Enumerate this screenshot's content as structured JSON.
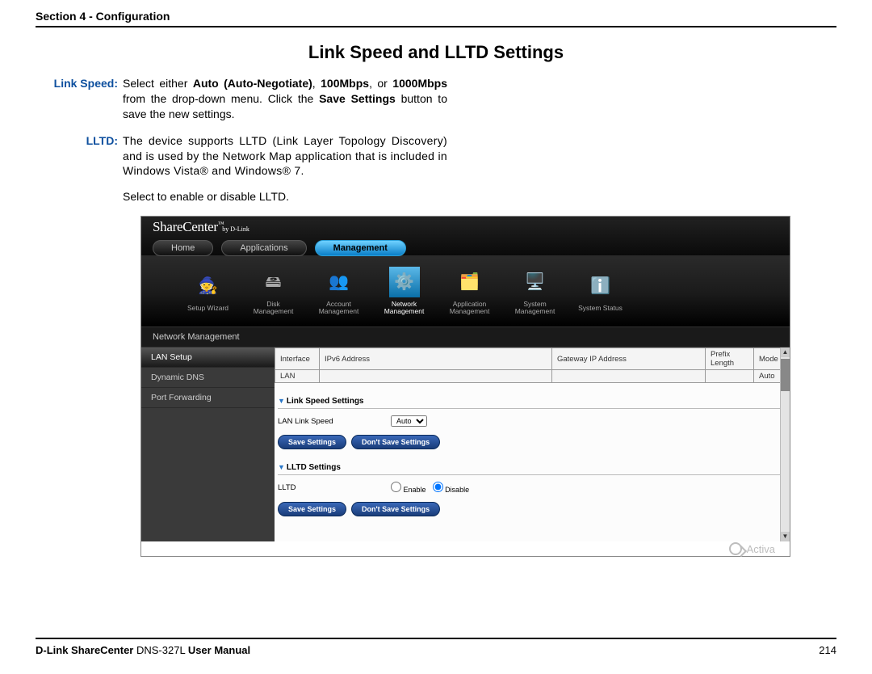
{
  "header": {
    "section": "Section 4 - Configuration"
  },
  "title": "Link Speed and LLTD Settings",
  "definitions": {
    "linkspeed": {
      "label": "Link Speed:",
      "text_parts": {
        "a": "Select either ",
        "b": "Auto (Auto-Negotiate)",
        "c": ", ",
        "d": "100Mbps",
        "e": ", or ",
        "f": "1000Mbps",
        "g": " from the drop-down menu. Click the ",
        "h": "Save Settings",
        "i": " button to save the new settings."
      }
    },
    "lltd": {
      "label": "LLTD:",
      "text": "The device supports LLTD (Link Layer Topology Discovery) and is used by the Network Map application that is included in Windows Vista® and Windows® 7."
    },
    "extra": "Select to enable or disable LLTD."
  },
  "screenshot": {
    "logo": "ShareCenter",
    "logo_tm": "™",
    "logo_sub": "by D-Link",
    "tabs": {
      "home": "Home",
      "apps": "Applications",
      "mgmt": "Management"
    },
    "toolbar": {
      "wizard": "Setup Wizard",
      "disk": "Disk\nManagement",
      "account": "Account\nManagement",
      "network": "Network\nManagement",
      "appmgmt": "Application\nManagement",
      "system": "System\nManagement",
      "status": "System Status"
    },
    "icons": {
      "wizard": "🧙",
      "disk": "🖴",
      "account": "👥",
      "network": "⚙️",
      "appmgmt": "🗂️",
      "system": "🖥️",
      "status": "ℹ️"
    },
    "subbar": "Network Management",
    "sidebar": {
      "lan": "LAN Setup",
      "ddns": "Dynamic DNS",
      "port": "Port Forwarding"
    },
    "table": {
      "headers": {
        "iface": "Interface",
        "ipv6": "IPv6 Address",
        "gw": "Gateway IP Address",
        "pfx": "Prefix Length",
        "mode": "Mode"
      },
      "row": {
        "iface": "LAN",
        "ipv6": "",
        "gw": "",
        "pfx": "",
        "mode": "Auto"
      }
    },
    "sections": {
      "linkspeed": {
        "title": "Link Speed Settings",
        "label": "LAN  Link Speed",
        "select_value": "Auto",
        "save": "Save Settings",
        "dont": "Don't Save Settings"
      },
      "lltd": {
        "title": "LLTD Settings",
        "label": "LLTD",
        "enable": "Enable",
        "disable": "Disable",
        "save": "Save Settings",
        "dont": "Don't Save Settings"
      }
    },
    "watermark": "Activa"
  },
  "footer": {
    "brand": "D-Link ShareCenter",
    "model": " DNS-327L ",
    "suffix": "User Manual",
    "page": "214"
  }
}
